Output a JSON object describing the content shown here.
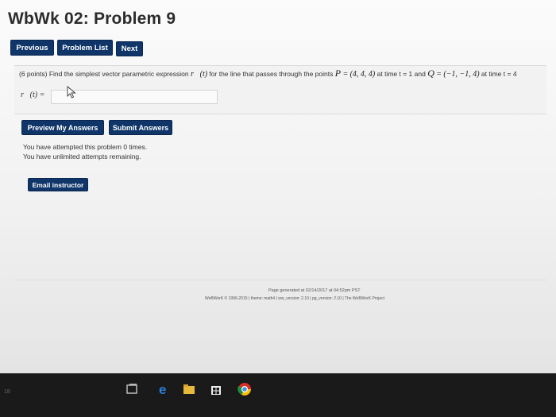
{
  "page": {
    "title": "WbWk 02: Problem 9"
  },
  "nav": {
    "previous": "Previous",
    "problem_list": "Problem List",
    "next": "Next"
  },
  "problem": {
    "points": "(6 points)",
    "text_1": "Find the simplest vector parametric expression",
    "r_of_t": "r⃗(t)",
    "text_2": "for the line that passes through the points",
    "p_label": "P",
    "eq": "=",
    "p_coords": "(4, 4, 4)",
    "at_time_1": "at time t = 1 and",
    "q_label": "Q",
    "q_coords": "(−1, −1, 4)",
    "at_time_2": "at time t = 4",
    "answer_label": "r⃗(t) =",
    "answer_value": ""
  },
  "actions": {
    "preview": "Preview My Answers",
    "submit": "Submit Answers",
    "email": "Email instructor"
  },
  "status": {
    "attempts": "You have attempted this problem 0 times.",
    "unlimited": "You have unlimited attempts remaining."
  },
  "footer": {
    "generated": "Page generated at 02/14/2017 at 04:52pm PST",
    "credits": "WeBWorK © 1996-2015 | theme: math4 | ww_version: 2.10 | pg_version: 2.10 | The WeBWorK Project"
  },
  "taskbar": {
    "left_text": "18",
    "icons": [
      "task-view-icon",
      "edge-icon",
      "file-explorer-icon",
      "store-icon",
      "chrome-icon"
    ]
  }
}
